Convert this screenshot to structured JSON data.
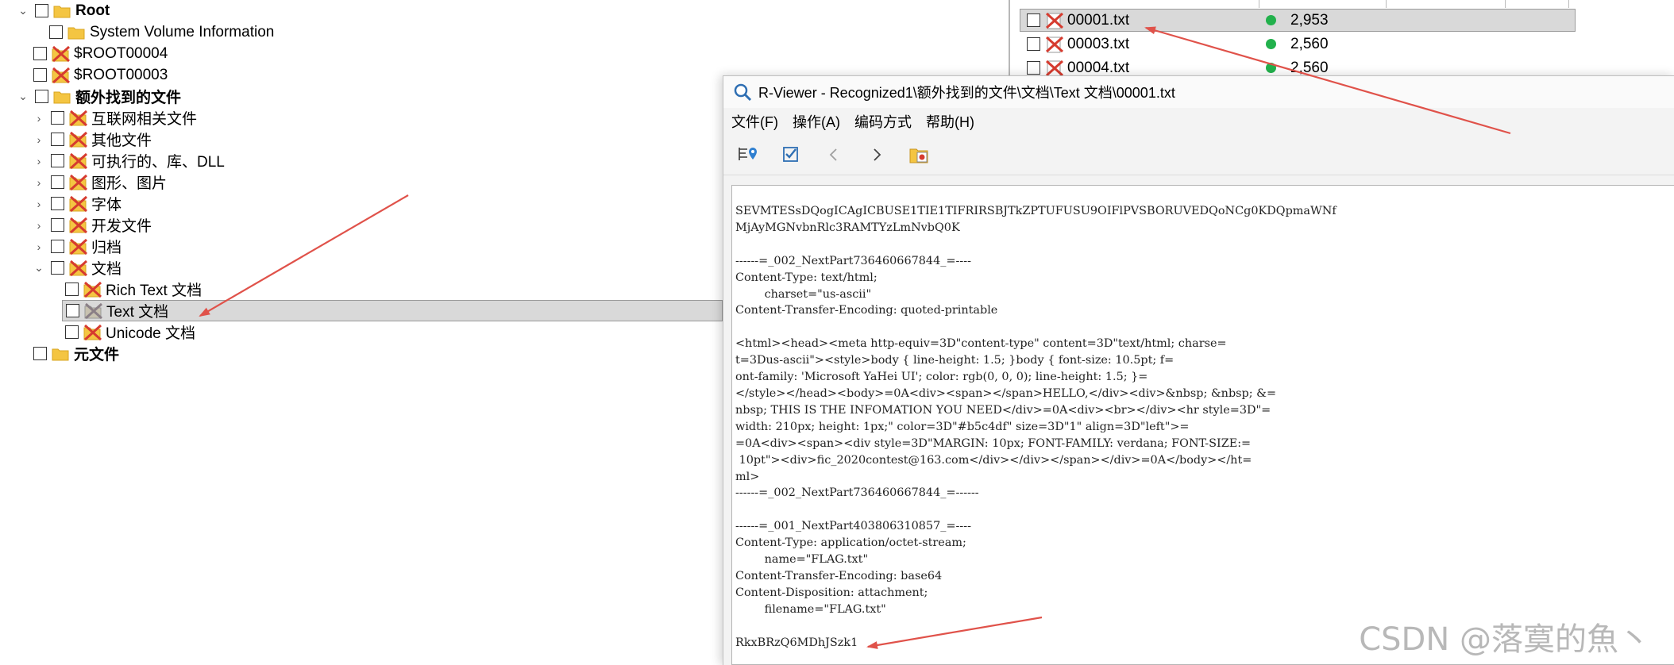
{
  "tree": {
    "items": [
      {
        "label": "Root",
        "bold": true,
        "chevron": "expanded",
        "icon": "folder-icon"
      },
      {
        "label": "System Volume Information",
        "icon": "folder-icon"
      },
      {
        "label": "$ROOT00004",
        "icon": "deleted-folder-icon"
      },
      {
        "label": "$ROOT00003",
        "icon": "deleted-folder-icon"
      },
      {
        "label": "额外找到的文件",
        "bold": true,
        "chevron": "expanded",
        "icon": "folder-icon"
      },
      {
        "label": "互联网相关文件",
        "chevron": "collapsed",
        "icon": "deleted-folder-icon"
      },
      {
        "label": "其他文件",
        "chevron": "collapsed",
        "icon": "deleted-folder-icon"
      },
      {
        "label": "可执行的、库、DLL",
        "chevron": "collapsed",
        "icon": "deleted-folder-icon"
      },
      {
        "label": "图形、图片",
        "chevron": "collapsed",
        "icon": "deleted-folder-icon"
      },
      {
        "label": "字体",
        "chevron": "collapsed",
        "icon": "deleted-folder-icon"
      },
      {
        "label": "开发文件",
        "chevron": "collapsed",
        "icon": "deleted-folder-icon"
      },
      {
        "label": "归档",
        "chevron": "collapsed",
        "icon": "deleted-folder-icon"
      },
      {
        "label": "文档",
        "chevron": "expanded",
        "icon": "deleted-folder-icon"
      },
      {
        "label": "Rich Text 文档",
        "icon": "deleted-folder-icon"
      },
      {
        "label": "Text 文档",
        "icon": "deleted-folder-icon",
        "selected": true
      },
      {
        "label": "Unicode 文档",
        "icon": "deleted-folder-icon"
      },
      {
        "label": "元文件",
        "bold": true,
        "icon": "folder-icon"
      }
    ]
  },
  "file_list": {
    "rows": [
      {
        "name": "00001.txt",
        "status": "green",
        "size": "2,953",
        "selected": true
      },
      {
        "name": "00003.txt",
        "status": "green",
        "size": "2,560"
      },
      {
        "name": "00004.txt",
        "status": "green",
        "size": "2,560"
      }
    ]
  },
  "viewer": {
    "title": "R-Viewer - Recognized1\\额外找到的文件\\文档\\Text 文档\\00001.txt",
    "menu": [
      "文件(F)",
      "操作(A)",
      "编码方式",
      "帮助(H)"
    ],
    "content": "SEVMTESsDQogICAgICBUSE1TIE1TIFRIRSBJTkZPTUFUSU9OIFlPVSBORUVEDQoNCg0KDQpmaWNf\nMjAyMGNvbnRlc3RAMTYzLmNvbQ0K\n\n------=_002_NextPart736460667844_=----\nContent-Type: text/html;\n        charset=\"us-ascii\"\nContent-Transfer-Encoding: quoted-printable\n\n<html><head><meta http-equiv=3D\"content-type\" content=3D\"text/html; charse=\nt=3Dus-ascii\"><style>body { line-height: 1.5; }body { font-size: 10.5pt; f=\nont-family: 'Microsoft YaHei UI'; color: rgb(0, 0, 0); line-height: 1.5; }=\n</style></head><body>=0A<div><span></span>HELLO,</div><div>&nbsp; &nbsp; &=\nnbsp; THIS IS THE INFOMATION YOU NEED</div>=0A<div><br></div><hr style=3D\"=\nwidth: 210px; height: 1px;\" color=3D\"#b5c4df\" size=3D\"1\" align=3D\"left\">=\n=0A<div><span><div style=3D\"MARGIN: 10px; FONT-FAMILY: verdana; FONT-SIZE:=\n 10pt\"><div>fic_2020contest@163.com</div></div></span></div>=0A</body></ht=\nml>\n------=_002_NextPart736460667844_=------\n\n------=_001_NextPart403806310857_=----\nContent-Type: application/octet-stream;\n        name=\"FLAG.txt\"\nContent-Transfer-Encoding: base64\nContent-Disposition: attachment;\n        filename=\"FLAG.txt\"\n\nRkxBRzQ6MDhJSzk1"
  },
  "watermark": "CSDN @落寞的魚丶",
  "colors": {
    "selected_row": "#d9d9d9",
    "arrow": "#e0524a",
    "status_green": "#22b14c",
    "deleted_x": "#d63b2f"
  }
}
